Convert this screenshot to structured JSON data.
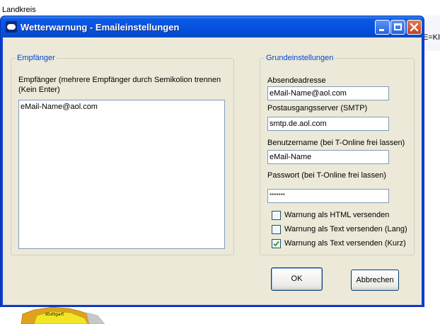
{
  "background": {
    "label": "Landkreis",
    "edge_text": "E=KI",
    "map_label": "stuttgart"
  },
  "window": {
    "title": "Wetterwarnung - Emaileinstellungen",
    "title_icon": "cloud-icon",
    "controls": {
      "minimize": "minimize-icon",
      "maximize": "maximize-icon",
      "close": "close-icon"
    }
  },
  "recipients": {
    "group_title": "Empfänger",
    "instructions_line1": "Empfänger (mehrere Empfänger durch Semikolion trennen",
    "instructions_line2": "(Kein Enter)",
    "value": "eMail-Name@aol.com"
  },
  "settings": {
    "group_title": "Grundeinstellungen",
    "sender_label": "Absendeadresse",
    "sender_value": "eMail-Name@aol.com",
    "smtp_label": "Postausgangsserver (SMTP)",
    "smtp_value": "smtp.de.aol.com",
    "username_label": "Benutzername (bei T-Online frei lassen)",
    "username_value": "eMail-Name",
    "password_label": "Passwort (bei T-Online frei lassen)",
    "password_value": "*******",
    "options": [
      {
        "label": "Warnung als HTML versenden",
        "checked": false
      },
      {
        "label": "Warnung als Text versenden (Lang)",
        "checked": false
      },
      {
        "label": "Warnung als Text versenden (Kurz)",
        "checked": true
      }
    ]
  },
  "buttons": {
    "ok": "OK",
    "cancel": "Abbrechen"
  }
}
